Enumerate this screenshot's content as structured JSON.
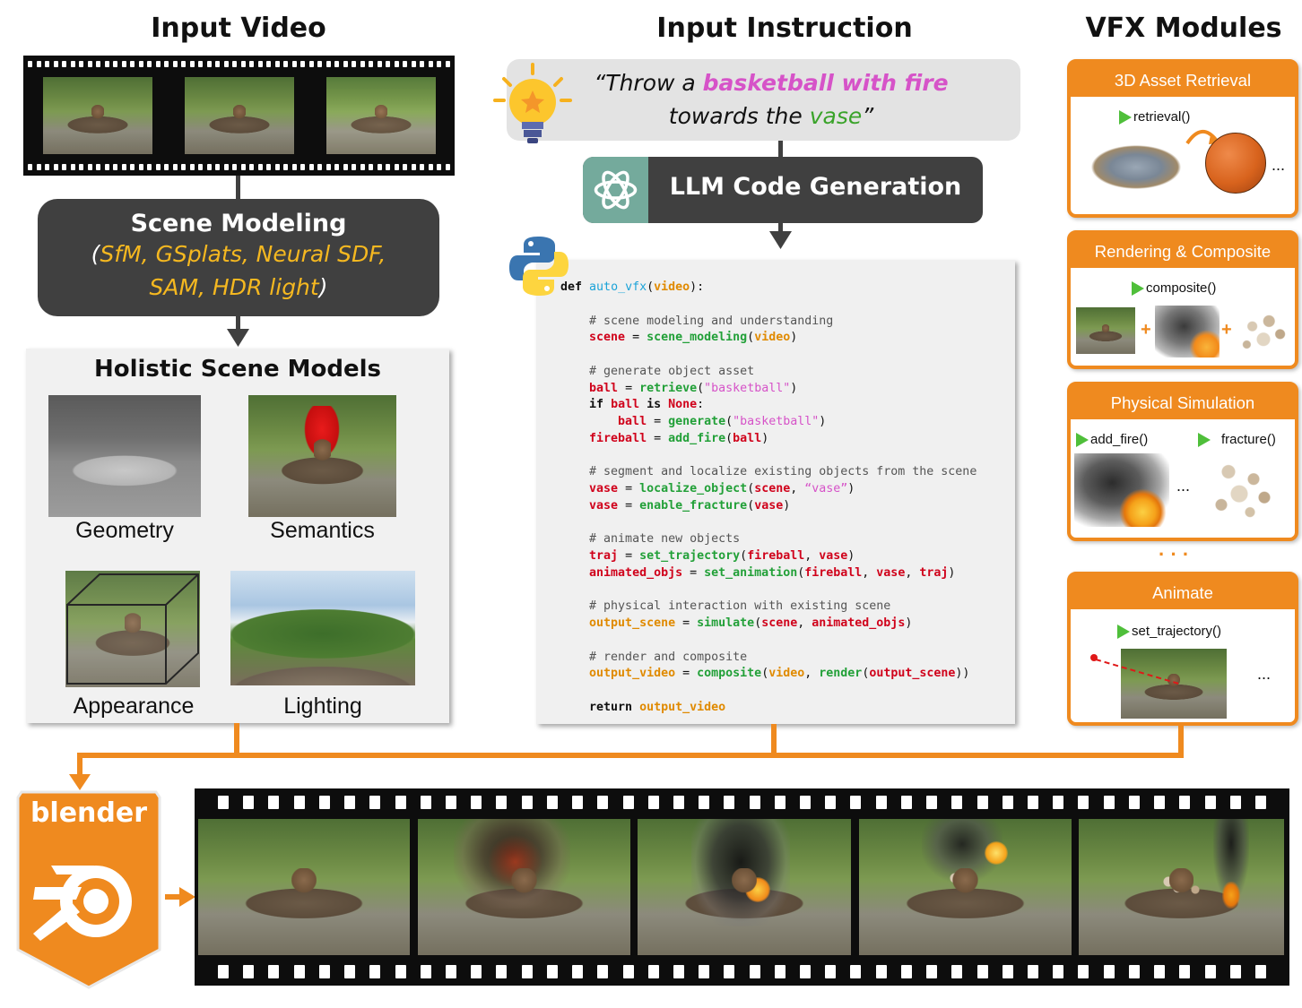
{
  "titles": {
    "input_video": "Input Video",
    "input_instruction": "Input Instruction",
    "vfx_modules": "VFX Modules"
  },
  "scene_modeling": {
    "title": "Scene Modeling",
    "open_paren": "(",
    "line1": "SfM, GSplats, Neural SDF,",
    "line2": "SAM, HDR light",
    "close_paren": ")"
  },
  "holistic": {
    "title": "Holistic Scene Models",
    "labels": [
      "Geometry",
      "Semantics",
      "Appearance",
      "Lighting"
    ]
  },
  "instruction": {
    "open": "“Throw a ",
    "highlight": "basketball with fire",
    "mid": "towards the ",
    "target": "vase",
    "close": "”"
  },
  "llm": {
    "label": "LLM Code Generation"
  },
  "code": {
    "def": "def",
    "fn_name": "auto_vfx",
    "param": "video",
    "comments": [
      "# scene modeling and understanding",
      "# generate object asset",
      "# segment and localize existing objects from the scene",
      "# animate new objects",
      "# physical interaction with existing scene",
      "# render and composite"
    ],
    "str_basketball": "\"basketball\"",
    "str_vase": "“vase”",
    "kw_if": "if",
    "kw_is": "is",
    "kw_none": "None",
    "kw_return": "return"
  },
  "modules": [
    {
      "title": "3D Asset Retrieval",
      "fn": "retrieval()"
    },
    {
      "title": "Rendering & Composite",
      "fn": "composite()"
    },
    {
      "title": "Physical Simulation",
      "fn": "add_fire()",
      "fn2": "fracture()"
    },
    {
      "title": "Animate",
      "fn": "set_trajectory()"
    }
  ],
  "ellipsis": "...",
  "vertical_dots": "· · ·",
  "blender": {
    "label": "blender"
  },
  "colors": {
    "orange": "#ef8a1f",
    "dark": "#404040",
    "yellow": "#f5b820",
    "pink": "#d653c8",
    "green": "#3aa32a",
    "code_red": "#d0021b",
    "code_green": "#22a038",
    "code_blue": "#1ba3d8",
    "code_orange": "#e08a00"
  },
  "icons": [
    "lightbulb-icon",
    "chatgpt-icon",
    "python-icon",
    "blender-logo-icon",
    "play-icon"
  ]
}
